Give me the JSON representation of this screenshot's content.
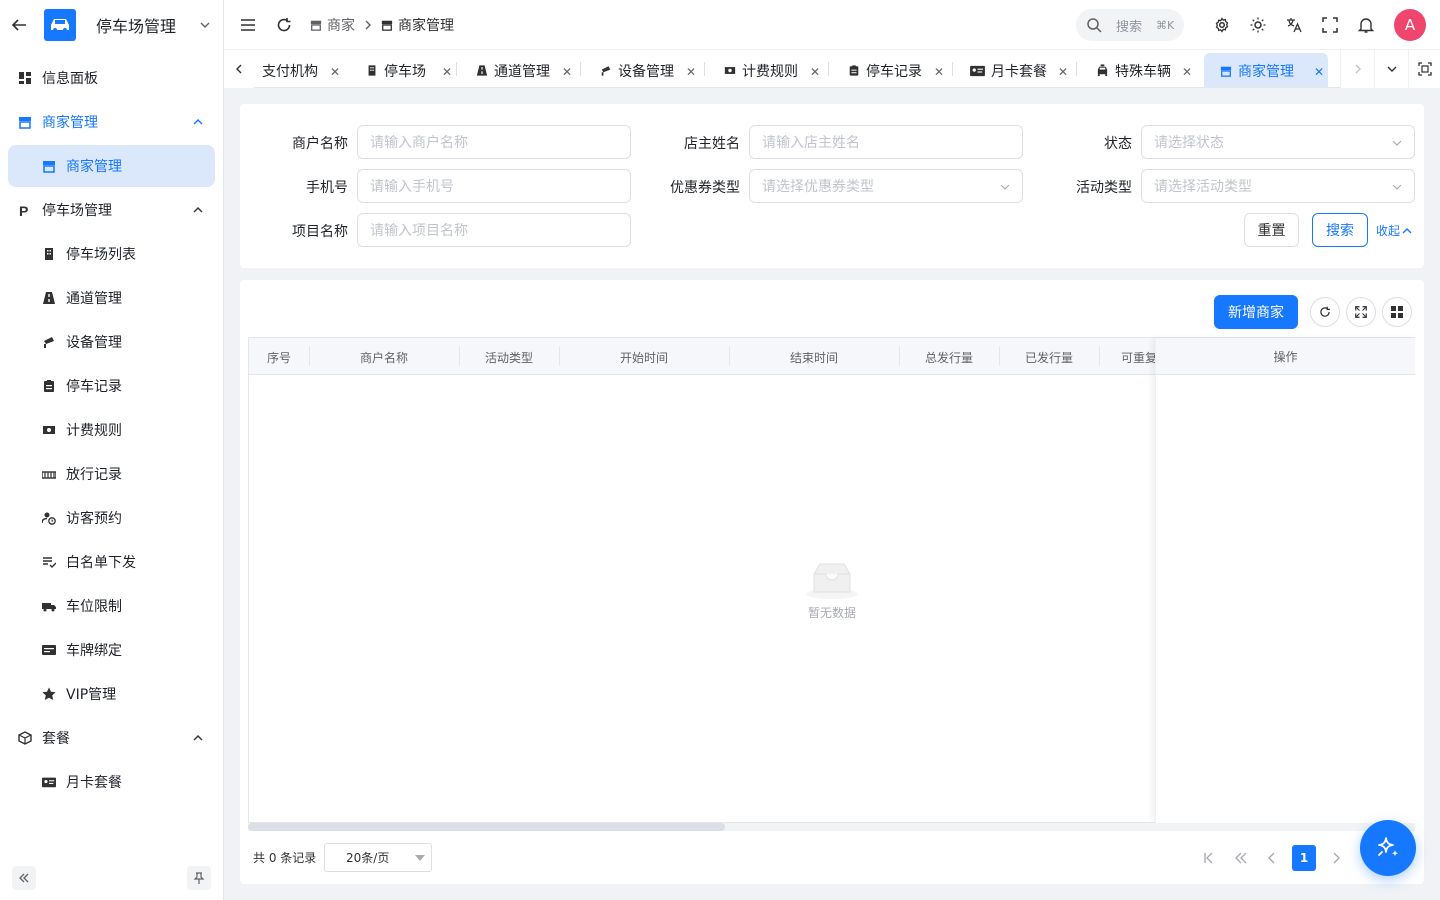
{
  "app": {
    "title": "停车场管理"
  },
  "sidebar": {
    "items": [
      {
        "label": "信息面板",
        "icon": "dashboard-icon"
      },
      {
        "label": "商家管理",
        "icon": "store-icon"
      },
      {
        "label": "商家管理",
        "icon": "store-icon"
      },
      {
        "label": "停车场管理",
        "icon": "parking-icon"
      },
      {
        "label": "停车场列表",
        "icon": "building-icon"
      },
      {
        "label": "通道管理",
        "icon": "road-icon"
      },
      {
        "label": "设备管理",
        "icon": "camera-icon"
      },
      {
        "label": "停车记录",
        "icon": "clipboard-icon"
      },
      {
        "label": "计费规则",
        "icon": "money-icon"
      },
      {
        "label": "放行记录",
        "icon": "gate-icon"
      },
      {
        "label": "访客预约",
        "icon": "visitor-clock-icon"
      },
      {
        "label": "白名单下发",
        "icon": "list-check-icon"
      },
      {
        "label": "车位限制",
        "icon": "truck-icon"
      },
      {
        "label": "车牌绑定",
        "icon": "card-icon"
      },
      {
        "label": "VIP管理",
        "icon": "star-icon"
      },
      {
        "label": "套餐",
        "icon": "package-icon"
      },
      {
        "label": "月卡套餐",
        "icon": "id-card-icon"
      }
    ]
  },
  "breadcrumb": {
    "parent": "商家",
    "current": "商家管理"
  },
  "header": {
    "search_placeholder": "搜索",
    "search_shortcut": "⌘K",
    "avatar_letter": "A"
  },
  "tabs": [
    {
      "label": "支付机构"
    },
    {
      "label": "停车场"
    },
    {
      "label": "通道管理"
    },
    {
      "label": "设备管理"
    },
    {
      "label": "计费规则"
    },
    {
      "label": "停车记录"
    },
    {
      "label": "月卡套餐"
    },
    {
      "label": "特殊车辆"
    },
    {
      "label": "商家管理"
    }
  ],
  "filters": {
    "merchant_name": {
      "label": "商户名称",
      "placeholder": "请输入商户名称"
    },
    "owner_name": {
      "label": "店主姓名",
      "placeholder": "请输入店主姓名"
    },
    "status": {
      "label": "状态",
      "placeholder": "请选择状态"
    },
    "phone": {
      "label": "手机号",
      "placeholder": "请输入手机号"
    },
    "coupon_type": {
      "label": "优惠券类型",
      "placeholder": "请选择优惠券类型"
    },
    "activity_type": {
      "label": "活动类型",
      "placeholder": "请选择活动类型"
    },
    "project_name": {
      "label": "项目名称",
      "placeholder": "请输入项目名称"
    },
    "reset_label": "重置",
    "search_label": "搜索",
    "collapse_label": "收起"
  },
  "toolbar": {
    "add_label": "新增商家"
  },
  "table": {
    "columns": [
      "序号",
      "商户名称",
      "活动类型",
      "开始时间",
      "结束时间",
      "总发行量",
      "已发行量",
      "可重复",
      "操作"
    ],
    "rows": [],
    "empty_text": "暂无数据"
  },
  "pagination": {
    "total_text": "共 0 条记录",
    "page_size": "20条/页",
    "current_page": "1"
  },
  "colors": {
    "primary": "#1677ff",
    "active_bg": "#dbe8fb",
    "avatar": "#f0466e"
  }
}
